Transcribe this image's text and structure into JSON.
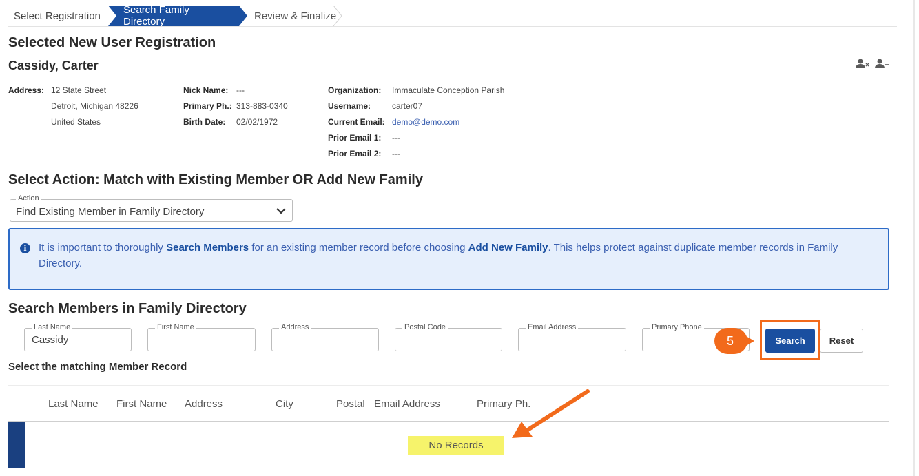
{
  "stepper": {
    "steps": [
      "Select Registration",
      "Search Family Directory",
      "Review & Finalize"
    ],
    "active_index": 1
  },
  "page_title": "Selected New User Registration",
  "user": {
    "name": "Cassidy, Carter",
    "address_label": "Address:",
    "address_lines": [
      "12 State Street",
      "Detroit, Michigan 48226",
      "United States"
    ],
    "nick_name_label": "Nick Name:",
    "nick_name": "---",
    "primary_phone_label": "Primary Ph.:",
    "primary_phone": "313-883-0340",
    "birth_date_label": "Birth Date:",
    "birth_date": "02/02/1972",
    "organization_label": "Organization:",
    "organization": "Immaculate Conception Parish",
    "username_label": "Username:",
    "username": "carter07",
    "current_email_label": "Current Email:",
    "current_email": "demo@demo.com",
    "prior_email1_label": "Prior Email 1:",
    "prior_email1": "---",
    "prior_email2_label": "Prior Email 2:",
    "prior_email2": "---"
  },
  "action_section": {
    "title": "Select Action: Match with Existing Member OR Add New Family",
    "select_legend": "Action",
    "select_value": "Find Existing Member in Family Directory"
  },
  "alert": {
    "text_before": "It is important to thoroughly ",
    "bold1": "Search Members",
    "text_middle": " for an existing member record before choosing ",
    "bold2": "Add New Family",
    "text_after": ". This helps protect against duplicate member records in Family Directory."
  },
  "search_section": {
    "title": "Search Members in Family Directory",
    "fields": {
      "last_name_label": "Last Name",
      "last_name_value": "Cassidy",
      "first_name_label": "First Name",
      "first_name_value": "",
      "address_label": "Address",
      "address_value": "",
      "postal_code_label": "Postal Code",
      "postal_code_value": "",
      "email_label": "Email Address",
      "email_value": "",
      "phone_label": "Primary Phone",
      "phone_value": ""
    },
    "search_button": "Search",
    "reset_button": "Reset",
    "step_badge": "5"
  },
  "results": {
    "label": "Select the matching Member Record",
    "columns": [
      "Last Name",
      "First Name",
      "Address",
      "City",
      "Postal",
      "Email Address",
      "Primary Ph."
    ],
    "empty_text": "No Records"
  },
  "colors": {
    "primary": "#1a4fa0",
    "annotation": "#f26a1b",
    "highlight": "#f6f36b",
    "alert_bg": "#e6effc"
  }
}
